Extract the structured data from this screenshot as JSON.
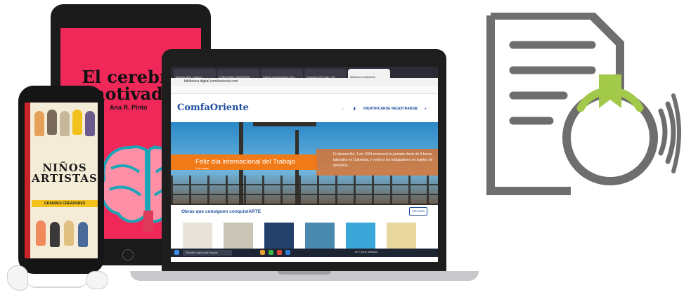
{
  "tablet": {
    "title_line1": "El cerebro",
    "title_line2": "motivado",
    "author": "Ana R. Pinto"
  },
  "phone": {
    "title_line1": "NIÑOS",
    "title_line2": "ARTISTAS",
    "subtitle": "GRANDES CREADORES"
  },
  "browser": {
    "url": "biblioteca digital.comfaoriente.com",
    "tabs": [
      "Bandeja (384) - plans.d...",
      "PUBLICIDAD COMFAORIE...",
      "Caja de Compensación Fam...",
      "Generador QR Code - QR",
      "Biblioteca Confaoriente"
    ]
  },
  "site": {
    "logo": "ComfaOriente",
    "nav": [
      "IDENTIFICARSE",
      "REGISTRARSE"
    ],
    "banner_title": "Feliz día internacional del Trabajo",
    "banner_sub": "1 de mayo",
    "decree_text": "El decreto No. 1 de 1934 reconoció la jornada diaria de 8 horas laborales en Colombia, y volvió a los trabajadores en sujetos de derechos.",
    "section_title": "Obras que consiguen conquistARTE",
    "see_more": "VER MÁS"
  },
  "taskbar": {
    "search_placeholder": "Escribe aquí para buscar",
    "weather": "19°C Muy nublado"
  },
  "colors": {
    "brand_blue": "#1b4d9c",
    "banner_orange": "#f07a18",
    "tablet_pink": "#f0285a",
    "icon_gray": "#6e6e6e",
    "ribbon_green": "#a3c94a"
  },
  "icons": [
    "document-icon",
    "audio-medal-icon",
    "sound-waves-icon"
  ]
}
